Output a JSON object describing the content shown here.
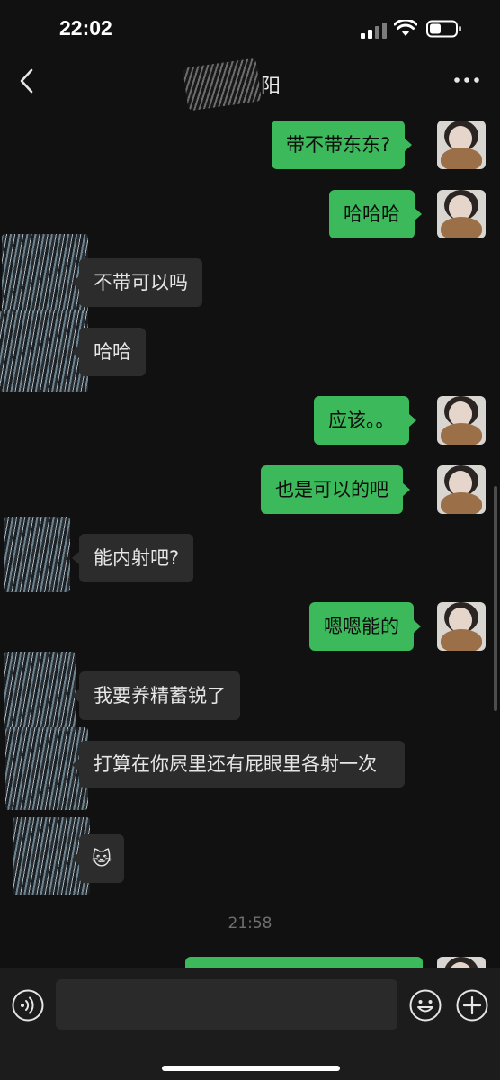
{
  "status_bar": {
    "time": "22:02"
  },
  "nav": {
    "title": "阳"
  },
  "messages": [
    {
      "side": "right",
      "text": "带不带东东?"
    },
    {
      "side": "right",
      "text": "哈哈哈"
    },
    {
      "side": "left",
      "text": "不带可以吗"
    },
    {
      "side": "left",
      "text": "哈哈"
    },
    {
      "side": "right",
      "text": "应该。。"
    },
    {
      "side": "right",
      "text": "也是可以的吧"
    },
    {
      "side": "left",
      "text": "能内射吧?"
    },
    {
      "side": "right",
      "text": "嗯嗯能的"
    },
    {
      "side": "left",
      "text": "我要养精蓄锐了"
    },
    {
      "side": "left",
      "text": "打算在你屄里还有屁眼里各射一次"
    },
    {
      "side": "left",
      "text": "🐱"
    }
  ],
  "timestamp": "21:58",
  "input": {
    "value": ""
  },
  "colors": {
    "my_bubble": "#3cb95a",
    "their_bubble": "#2c2c2c",
    "background": "#111111"
  },
  "icons": [
    "back-chevron-icon",
    "more-dots-icon",
    "voice-icon",
    "emoji-icon",
    "plus-icon",
    "signal-icon",
    "wifi-icon",
    "battery-icon"
  ]
}
